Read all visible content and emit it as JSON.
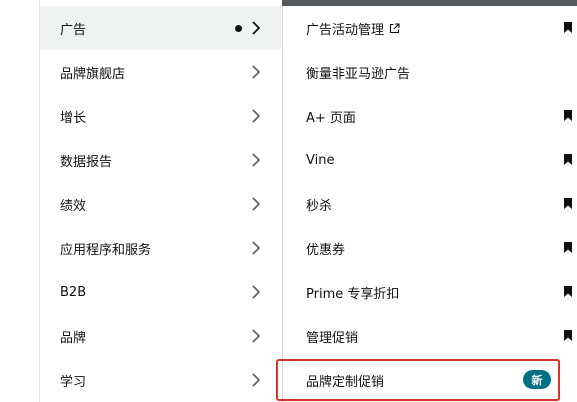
{
  "left_menu": {
    "items": [
      {
        "label": "广告"
      },
      {
        "label": "品牌旗舰店"
      },
      {
        "label": "增长"
      },
      {
        "label": "数据报告"
      },
      {
        "label": "绩效"
      },
      {
        "label": "应用程序和服务"
      },
      {
        "label": "B2B"
      },
      {
        "label": "品牌"
      },
      {
        "label": "学习"
      }
    ],
    "active_index": 0
  },
  "right_menu": {
    "items": [
      {
        "label": "广告活动管理",
        "icon": "external-link-icon",
        "bookmarked": true
      },
      {
        "label": "衡量非亚马逊广告",
        "bookmarked": false
      },
      {
        "label": "A+ 页面",
        "bookmarked": true
      },
      {
        "label": "Vine",
        "bookmarked": true
      },
      {
        "label": "秒杀",
        "bookmarked": true
      },
      {
        "label": "优惠券",
        "bookmarked": true
      },
      {
        "label": "Prime 专享折扣",
        "bookmarked": true
      },
      {
        "label": "管理促销",
        "bookmarked": true
      },
      {
        "label": "品牌定制促销",
        "bookmarked": false,
        "badge": "新"
      }
    ]
  },
  "colors": {
    "highlight": "#d9342b",
    "badge_bg": "#007185",
    "active_bg": "#f0f2f2",
    "top_bar": "#55595c"
  }
}
